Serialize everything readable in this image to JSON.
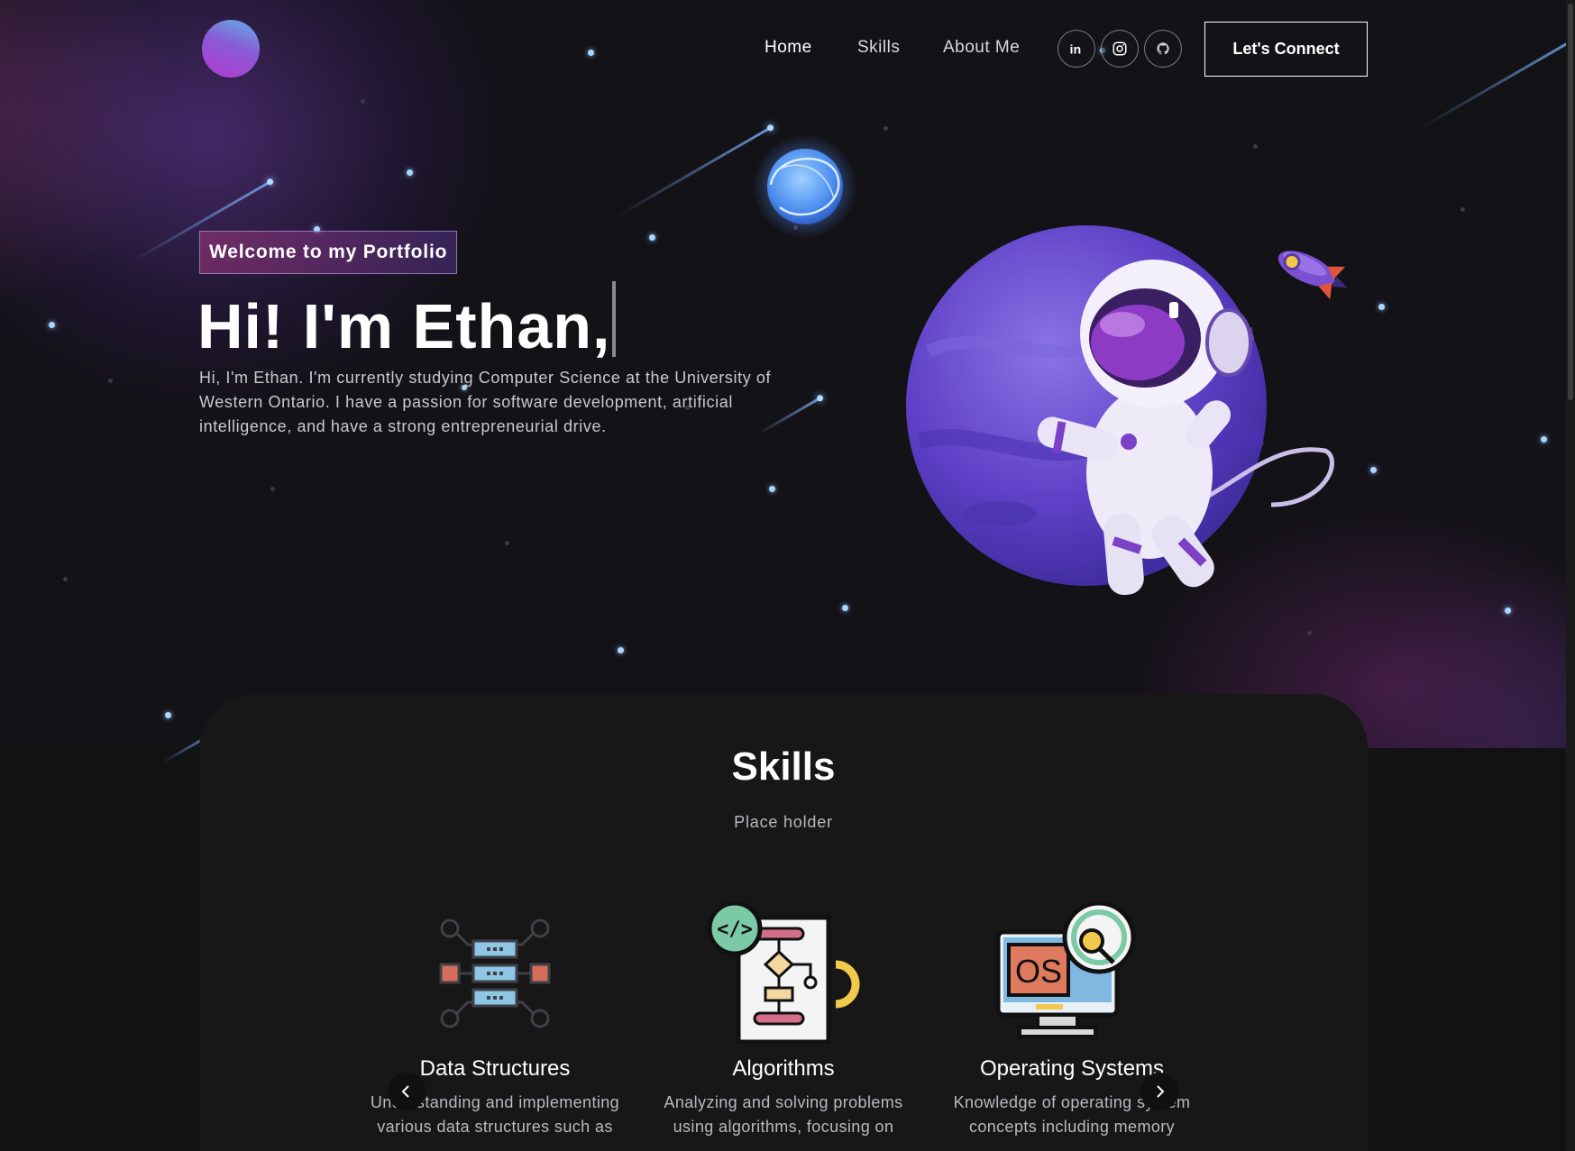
{
  "nav": {
    "links": [
      {
        "label": "Home",
        "active": true
      },
      {
        "label": "Skills",
        "active": false
      },
      {
        "label": "About Me",
        "active": false
      }
    ],
    "social_icons": [
      "linkedin-icon",
      "instagram-icon",
      "github-icon"
    ],
    "connect_label": "Let's Connect"
  },
  "hero": {
    "tagline": "Welcome to my Portfolio",
    "title": "Hi! I'm Ethan,",
    "description": "Hi, I'm Ethan. I'm currently studying Computer Science at the University of Western Ontario. I have a passion for software development, artificial intelligence, and have a strong entrepreneurial drive."
  },
  "skills": {
    "title": "Skills",
    "subtitle": "Place holder",
    "items": [
      {
        "name": "Data Structures",
        "description": "Understanding and implementing various data structures such as",
        "icon": "server-icon"
      },
      {
        "name": "Algorithms",
        "description": "Analyzing and solving problems using algorithms, focusing on",
        "icon": "flowchart-code-icon"
      },
      {
        "name": "Operating Systems",
        "description": "Knowledge of operating system concepts including memory",
        "icon": "os-monitor-icon"
      }
    ],
    "prev_icon": "chevron-left-icon",
    "next_icon": "chevron-right-icon"
  },
  "colors": {
    "background": "#121212",
    "card": "#171717",
    "accent_pink": "#AA367C",
    "accent_purple": "#4A2FBD",
    "star": "#a9d6ff"
  }
}
